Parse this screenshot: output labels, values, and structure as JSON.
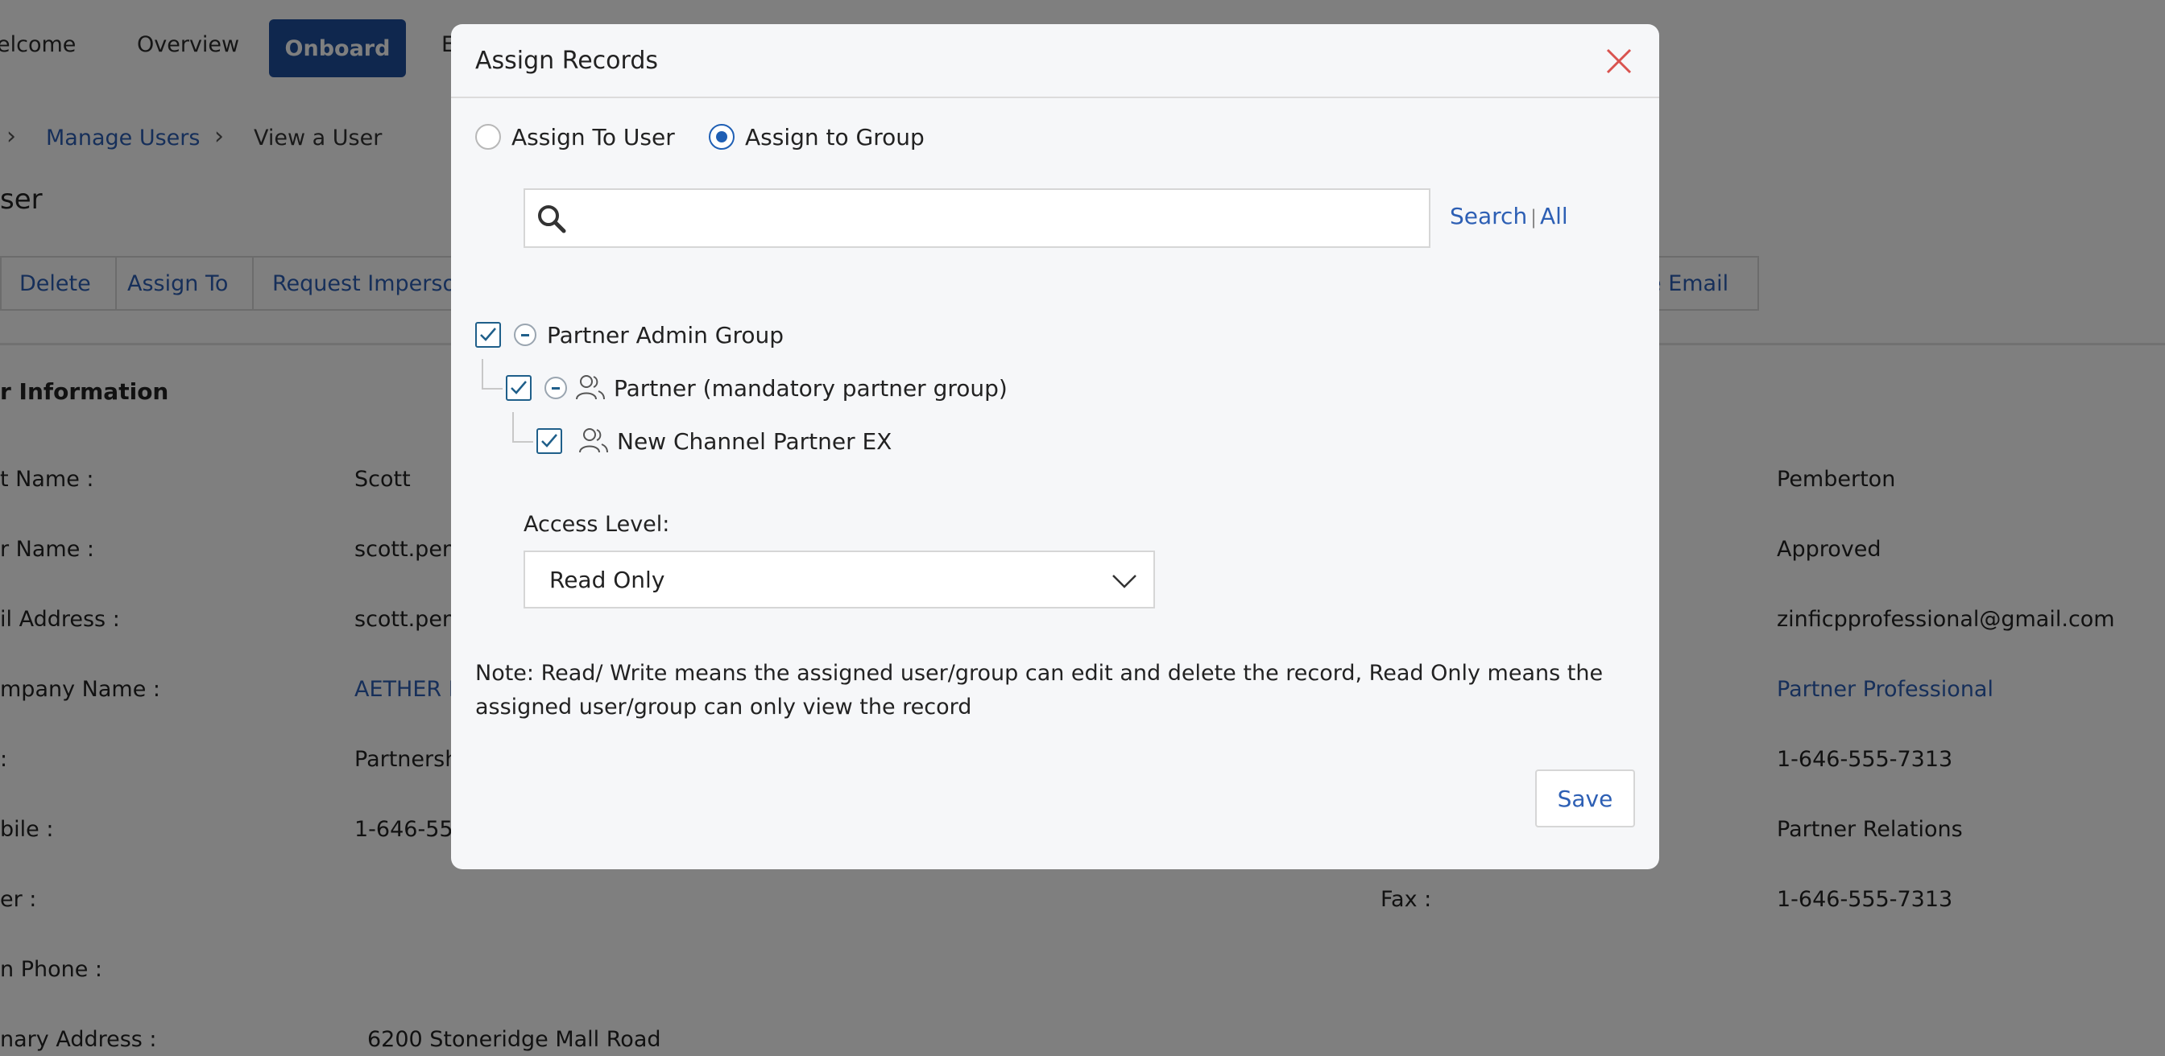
{
  "nav": {
    "items": [
      "elcome",
      "Overview",
      "Onboard",
      "E"
    ],
    "active_index": 2
  },
  "breadcrumb": {
    "link": "Manage Users",
    "current": "View a User"
  },
  "page_title": "ser",
  "actions": [
    "Delete",
    "Assign To",
    "Request Imperson",
    "e Email"
  ],
  "section_title": "r Information",
  "fields_left": [
    {
      "label": "t Name :",
      "value": "Scott"
    },
    {
      "label": "r Name :",
      "value": "scott.pem"
    },
    {
      "label": "il Address :",
      "value": "scott.pem"
    },
    {
      "label": "mpany Name :",
      "value": "AETHER P"
    },
    {
      "label": ":",
      "value": "Partnersh"
    },
    {
      "label": "bile :",
      "value": "1-646-55"
    },
    {
      "label": "er :",
      "value": ""
    },
    {
      "label": "n Phone :",
      "value": ""
    },
    {
      "label": "nary Address :",
      "value": "6200 Stoneridge Mall Road"
    }
  ],
  "fields_right": [
    {
      "label": "",
      "value": "Pemberton"
    },
    {
      "label": "",
      "value": "Approved"
    },
    {
      "label": "",
      "value": "zinficpprofessional@gmail.com"
    },
    {
      "label": "",
      "value": "Partner Professional"
    },
    {
      "label": "",
      "value": "1-646-555-7313"
    },
    {
      "label": "",
      "value": "Partner Relations"
    },
    {
      "label": "Fax :",
      "value": "1-646-555-7313"
    }
  ],
  "modal": {
    "title": "Assign Records",
    "radio_user": "Assign To User",
    "radio_group": "Assign to Group",
    "selected": "group",
    "search": {
      "placeholder": "",
      "value": "",
      "search_label": "Search",
      "separator": "|",
      "all_label": "All"
    },
    "tree": [
      {
        "label": "Partner Admin Group",
        "checked": true,
        "level": 0
      },
      {
        "label": "Partner (mandatory partner group)",
        "checked": true,
        "level": 1
      },
      {
        "label": "New Channel Partner EX",
        "checked": true,
        "level": 2
      }
    ],
    "access_level_label": "Access Level:",
    "access_level_value": "Read Only",
    "note": "Note: Read/ Write means the assigned user/group can edit and delete the record, Read Only means the assigned user/group can only view the record",
    "save_label": "Save"
  },
  "colors": {
    "accent": "#1f4e9c",
    "link": "#2d5fb4",
    "close": "#d9534f",
    "check": "#1f5f8a"
  },
  "icons": [
    "search-icon",
    "close-icon",
    "chevron-down-icon",
    "users-icon",
    "check-icon",
    "chevron-right-icon"
  ]
}
